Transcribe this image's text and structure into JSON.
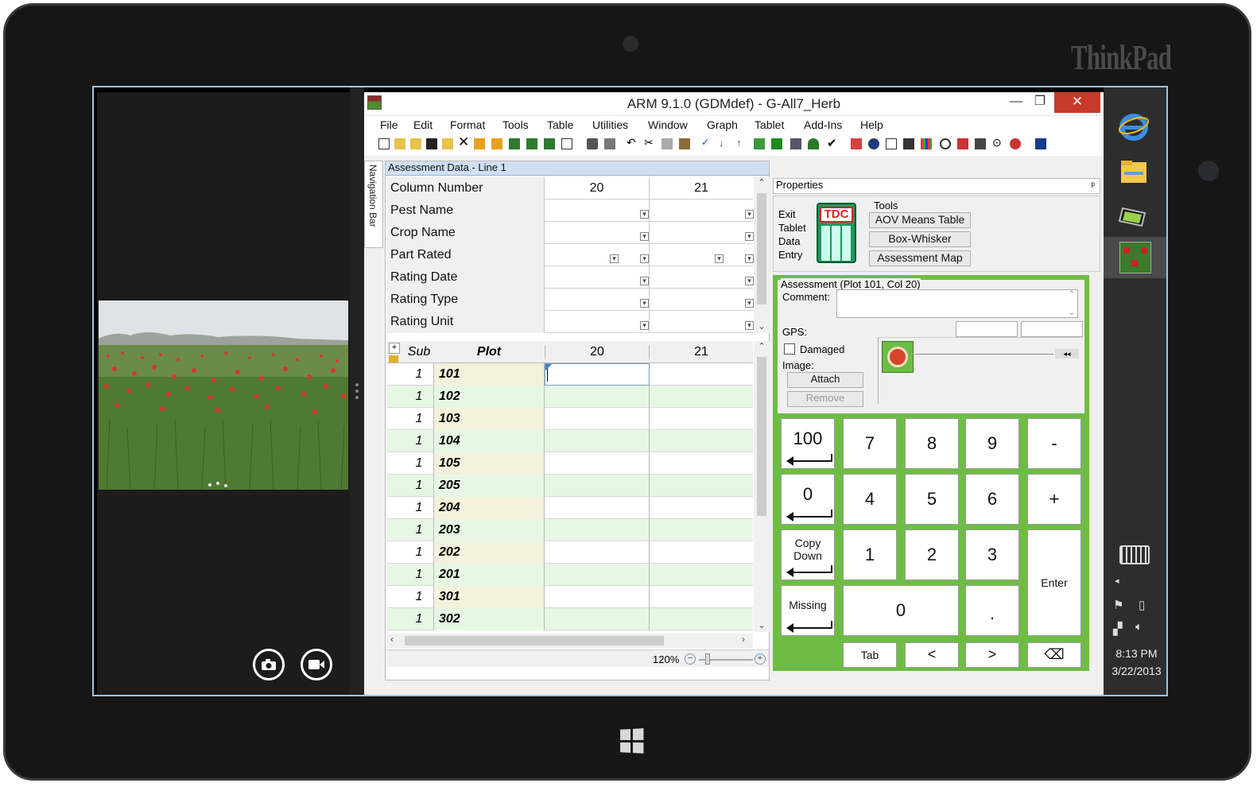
{
  "device": {
    "brand": "ThinkPad"
  },
  "window": {
    "title": "ARM 9.1.0 (GDMdef) - G-All7_Herb",
    "minimize": "—",
    "maximize": "❐",
    "close": "✕"
  },
  "menu": [
    "File",
    "Edit",
    "Format",
    "Tools",
    "Table",
    "Utilities",
    "Window",
    "Graph",
    "Tablet",
    "Add-Ins",
    "Help"
  ],
  "nav_bar": {
    "label": "Navigation Bar"
  },
  "grid": {
    "title": "Assessment Data - Line 1",
    "header_rows": [
      {
        "label": "Column Number",
        "c20": "20",
        "c21": "21"
      },
      {
        "label": "Pest Name",
        "c20": "",
        "c21": ""
      },
      {
        "label": "Crop Name",
        "c20": "",
        "c21": ""
      },
      {
        "label": "Part Rated",
        "c20": "",
        "c21": ""
      },
      {
        "label": "Rating Date",
        "c20": "",
        "c21": ""
      },
      {
        "label": "Rating Type",
        "c20": "",
        "c21": ""
      },
      {
        "label": "Rating Unit",
        "c20": "",
        "c21": ""
      }
    ],
    "col_headers": {
      "plus": "+",
      "sub": "Sub",
      "plot": "Plot",
      "c20": "20",
      "c21": "21"
    },
    "rows": [
      {
        "sub": "1",
        "plot": "101"
      },
      {
        "sub": "1",
        "plot": "102"
      },
      {
        "sub": "1",
        "plot": "103"
      },
      {
        "sub": "1",
        "plot": "104"
      },
      {
        "sub": "1",
        "plot": "105"
      },
      {
        "sub": "1",
        "plot": "205"
      },
      {
        "sub": "1",
        "plot": "204"
      },
      {
        "sub": "1",
        "plot": "203"
      },
      {
        "sub": "1",
        "plot": "202"
      },
      {
        "sub": "1",
        "plot": "201"
      },
      {
        "sub": "1",
        "plot": "301"
      },
      {
        "sub": "1",
        "plot": "302"
      }
    ],
    "zoom": "120%"
  },
  "properties": {
    "title": "Properties",
    "pin": "ᵖ",
    "exit_tablet_label": "Exit\nTablet\nData\nEntry",
    "tdc_label": "TDC",
    "tools_label": "Tools",
    "tool_buttons": [
      "AOV Means Table",
      "Box-Whisker",
      "Assessment Map"
    ]
  },
  "assessment": {
    "title": "Assessment (Plot  101, Col  20)",
    "comment_label": "Comment:",
    "gps_label": "GPS:",
    "damaged_label": "Damaged",
    "image_label": "Image:",
    "attach": "Attach",
    "remove": "Remove"
  },
  "keypad": {
    "k100": "100",
    "k0top": "0",
    "copy": "Copy",
    "down": "Down",
    "missing": "Missing",
    "k7": "7",
    "k8": "8",
    "k9": "9",
    "minus": "-",
    "k4": "4",
    "k5": "5",
    "k6": "6",
    "plus": "+",
    "k1": "1",
    "k2": "2",
    "k3": "3",
    "enter": "Enter",
    "k0": "0",
    "dot": ".",
    "tab": "Tab",
    "left": "<",
    "right": ">",
    "backspace": "⌫"
  },
  "system": {
    "time": "8:13 PM",
    "date": "3/22/2013"
  },
  "colors": {
    "accent_green": "#6dbd45",
    "row_green": "#e6f8e3",
    "plot_cell": "#f4f1dc",
    "close_red": "#c7392b",
    "title_blue": "#cfe0f3"
  }
}
